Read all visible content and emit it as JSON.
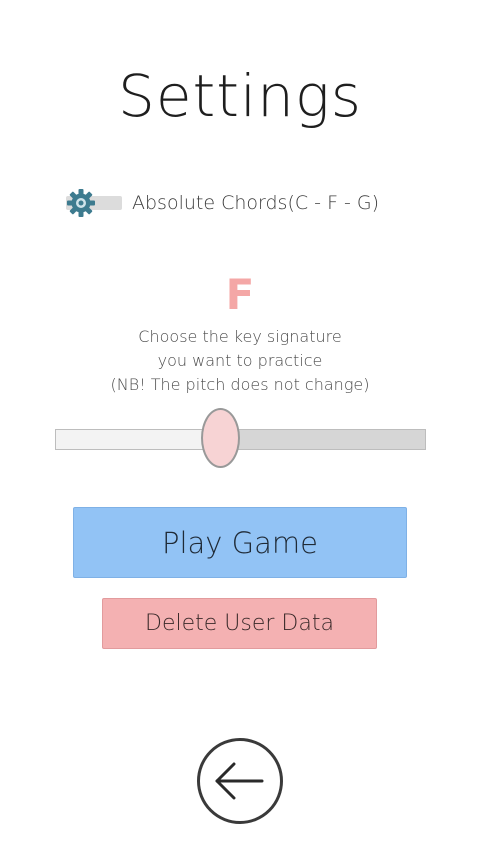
{
  "page": {
    "title": "Settings"
  },
  "chord_toggle": {
    "label": "Absolute Chords(C - F - G)",
    "icon": "gear-icon",
    "enabled": false
  },
  "key_signature": {
    "current_key": "F",
    "hint_lines": [
      "Choose the key signature",
      "you want to practice",
      "(NB! The pitch does not change)"
    ],
    "slider_position": 0.45
  },
  "buttons": {
    "play_label": "Play Game",
    "delete_label": "Delete User Data",
    "back_icon": "arrow-left-icon"
  },
  "colors": {
    "accent_key": "#f4a7a6",
    "play_button": "#92c3f5",
    "delete_button": "#f4b1b2",
    "slider_handle": "#f7d3d4",
    "gear_icon": "#3d7b8f"
  }
}
